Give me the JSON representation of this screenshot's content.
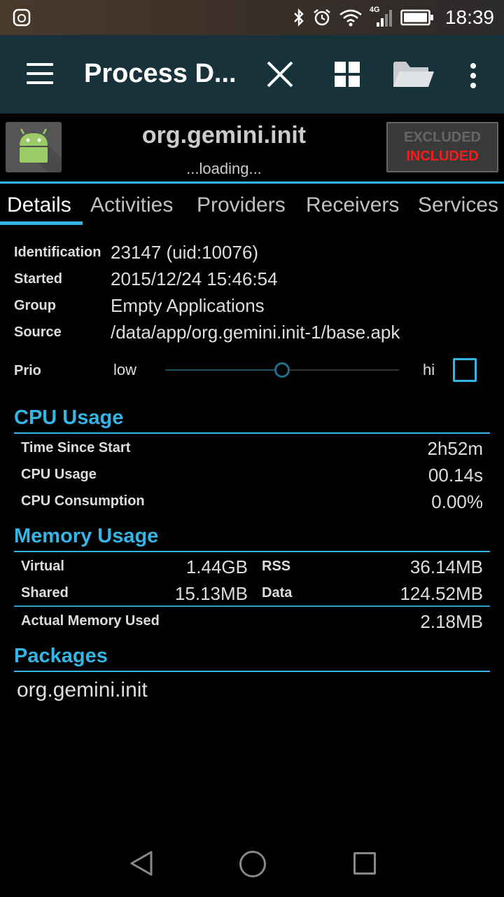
{
  "status_bar": {
    "time": "18:39",
    "network": "4G",
    "icons": [
      "notification-icon",
      "bluetooth-icon",
      "alarm-icon",
      "wifi-icon",
      "signal-icon",
      "battery-icon"
    ]
  },
  "toolbar": {
    "title": "Process D...",
    "menu_icon": "hamburger-icon",
    "close_icon": "close-icon",
    "grid_icon": "grid-icon",
    "folder_icon": "folder-icon",
    "more_icon": "overflow-menu-icon"
  },
  "app": {
    "name": "org.gemini.init",
    "subtitle": "...loading...",
    "excluded_label": "EXCLUDED",
    "included_label": "INCLUDED"
  },
  "tabs": [
    "Details",
    "Activities",
    "Providers",
    "Receivers",
    "Services"
  ],
  "details": {
    "identification_label": "Identification",
    "identification_value": "23147 (uid:10076)",
    "started_label": "Started",
    "started_value": "2015/12/24 15:46:54",
    "group_label": "Group",
    "group_value": "Empty Applications",
    "source_label": "Source",
    "source_value": "/data/app/org.gemini.init-1/base.apk",
    "prio_label": "Prio",
    "prio_low": "low",
    "prio_hi": "hi",
    "prio_level": 0.5,
    "prio_checked": false
  },
  "cpu": {
    "title": "CPU Usage",
    "rows": [
      {
        "label": "Time Since Start",
        "value": "2h52m"
      },
      {
        "label": "CPU Usage",
        "value": "00.14s"
      },
      {
        "label": "CPU Consumption",
        "value": "0.00%"
      }
    ]
  },
  "memory": {
    "title": "Memory Usage",
    "virtual_label": "Virtual",
    "virtual_value": "1.44GB",
    "rss_label": "RSS",
    "rss_value": "36.14MB",
    "shared_label": "Shared",
    "shared_value": "15.13MB",
    "data_label": "Data",
    "data_value": "124.52MB",
    "actual_label": "Actual Memory Used",
    "actual_value": "2.18MB"
  },
  "packages": {
    "title": "Packages",
    "items": [
      "org.gemini.init"
    ]
  },
  "colors": {
    "accent": "#33b5e5",
    "toolbar": "#18323c",
    "included": "#ff1a1a"
  }
}
